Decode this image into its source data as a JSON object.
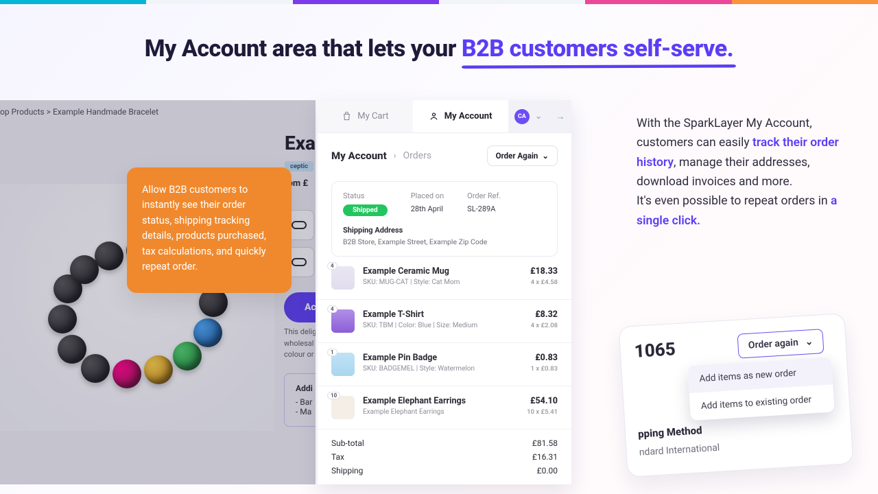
{
  "headline": {
    "pre": "My Account area that lets your ",
    "hl": "B2B customers self-serve."
  },
  "bg": {
    "crumbs_pre": "op Products > ",
    "crumbs_item": "Example Handmade Bracelet",
    "title": "Exan",
    "chip": "ceptic",
    "from": "rom £",
    "add": "Ac",
    "desc_l1": "This delig",
    "desc_l2": "wholesal",
    "desc_l3": "colour or",
    "info_h": "Addi",
    "info_a": "- Bar",
    "info_b": "- Ma"
  },
  "hint": "Allow B2B customers to instantly see their order status, shipping tracking details, products purchased, tax calculations, and quickly repeat order.",
  "panel": {
    "tab_cart": "My Cart",
    "tab_account": "My Account",
    "avatar": "CA",
    "crumb_a": "My Account",
    "crumb_b": "Orders",
    "order_again": "Order Again",
    "status_lbl": "Status",
    "status_val": "Shipped",
    "placed_lbl": "Placed on",
    "placed_val": "28th April",
    "ref_lbl": "Order Ref.",
    "ref_val": "SL-289A",
    "ship_lbl": "Shipping Address",
    "ship_val": "B2B Store, Example Street, Example Zip Code",
    "items": [
      {
        "qty": "4",
        "name": "Example Ceramic Mug",
        "meta": "SKU: MUG-CAT | Style: Cat Mom",
        "price": "£18.33",
        "brk": "4 x £4.58"
      },
      {
        "qty": "4",
        "name": "Example T-Shirt",
        "meta": "SKU: TBM | Color: Blue | Size: Medium",
        "price": "£8.32",
        "brk": "4 x £2.08"
      },
      {
        "qty": "1",
        "name": "Example Pin Badge",
        "meta": "SKU: BADGEMEL | Style: Watermelon",
        "price": "£0.83",
        "brk": "1 x £0.83"
      },
      {
        "qty": "10",
        "name": "Example Elephant Earrings",
        "meta": "Example Elephant Earrings",
        "price": "£54.10",
        "brk": "10 x  £5.41"
      }
    ],
    "subtotal_lbl": "Sub-total",
    "subtotal_val": "£81.58",
    "tax_lbl": "Tax",
    "tax_val": "£16.31",
    "ship_tot_lbl": "Shipping",
    "ship_tot_val": "£0.00"
  },
  "copy": {
    "a": "With the SparkLayer My Account, customers can easily ",
    "b": "track their order history",
    "c": ", manage their addresses, download invoices and more.",
    "d": "It's even possible to repeat orders in ",
    "e": "a single click."
  },
  "dd": {
    "num": "1065",
    "btn": "Order again",
    "opt1": "Add items as new order",
    "opt2": "Add items to existing order",
    "sm_lbl": "pping Method",
    "sm_val": "ndard International"
  }
}
